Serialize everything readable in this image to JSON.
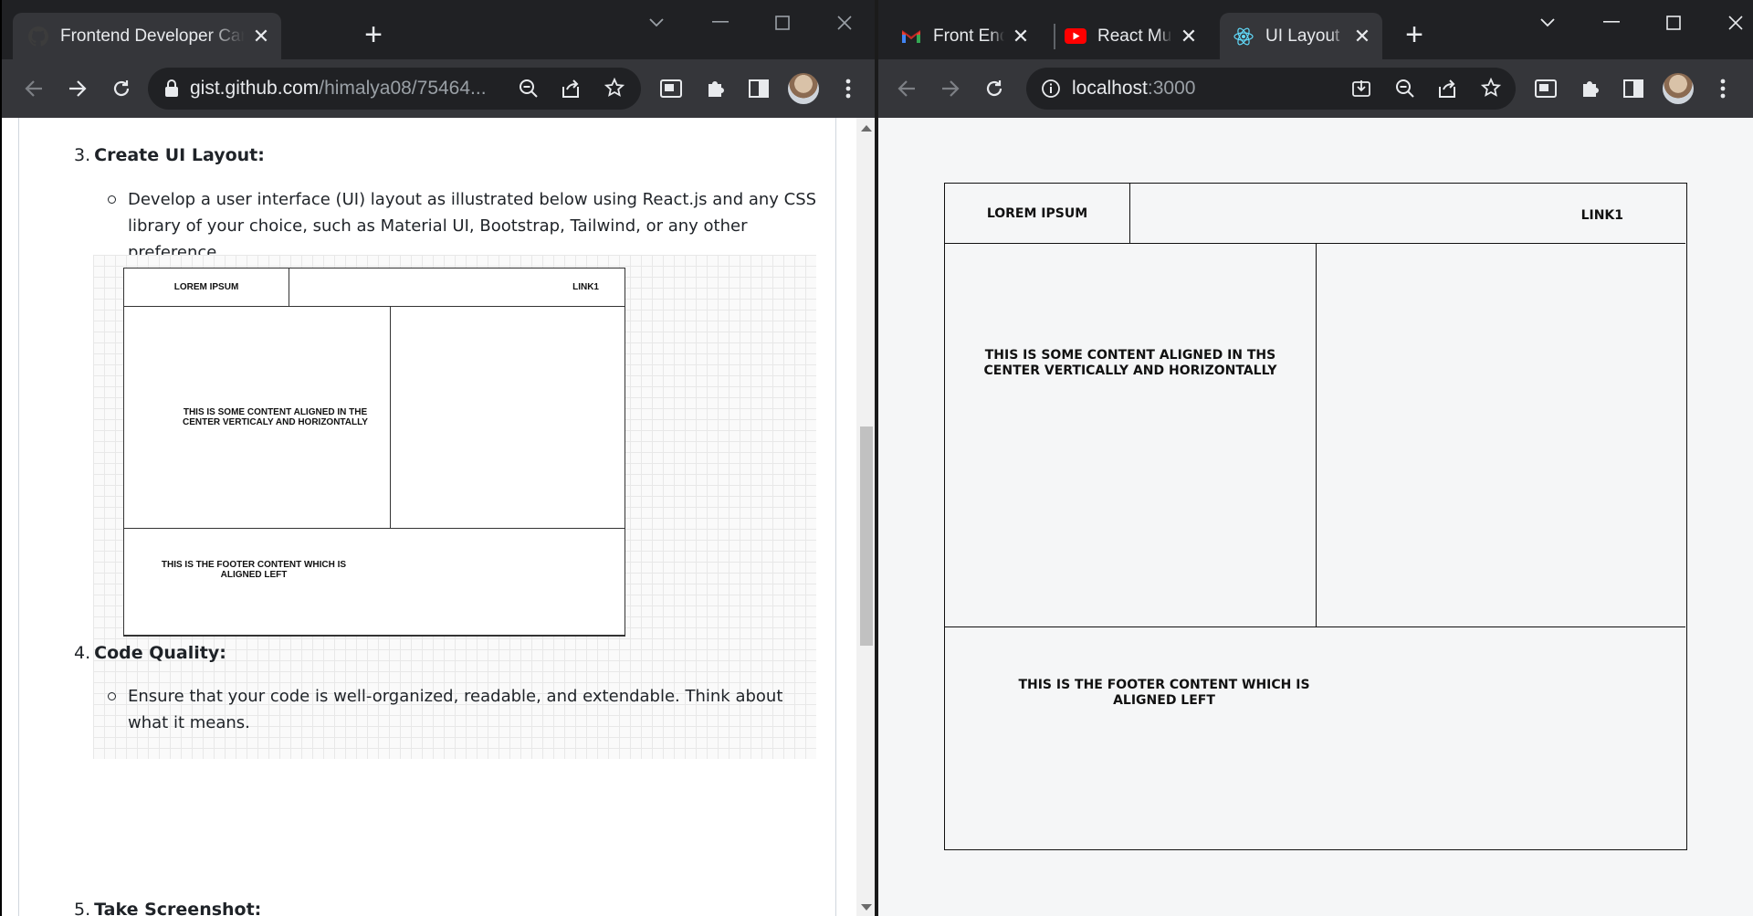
{
  "left_window": {
    "tabs": [
      {
        "title": "Frontend Developer Candidate Screening",
        "active": true
      }
    ],
    "url": {
      "host": "gist.github.com",
      "path": "/himalya08/75464..."
    },
    "doc": {
      "items": [
        {
          "num": "3.",
          "heading": "Create UI Layout:",
          "bullet": "Develop a user interface (UI) layout as illustrated below using React.js and any CSS library of your choice, such as Material UI, Bootstrap, Tailwind, or any other preference."
        },
        {
          "num": "4.",
          "heading": "Code Quality:",
          "bullet": "Ensure that your code is well-organized, readable, and extendable. Think about what it means."
        },
        {
          "num": "5.",
          "heading": "Take Screenshot:"
        }
      ],
      "mock": {
        "logo": "LOREM IPSUM",
        "link": "LINK1",
        "center": "THIS IS SOME CONTENT ALIGNED IN THE CENTER VERTICALY AND HORIZONTALLY",
        "footer": "THIS IS THE FOOTER CONTENT WHICH IS ALIGNED LEFT"
      }
    }
  },
  "right_window": {
    "tabs": [
      {
        "title": "Front End Developer",
        "active": false
      },
      {
        "title": "React Multi",
        "active": false
      },
      {
        "title": "UI Layout",
        "active": true
      }
    ],
    "url": {
      "host": "localhost",
      "port": ":3000"
    },
    "app": {
      "logo": "LOREM IPSUM",
      "link": "LINK1",
      "center": "THIS IS SOME CONTENT ALIGNED IN THS CENTER VERTICALLY AND HORIZONTALLY",
      "footer": "THIS IS THE FOOTER CONTENT WHICH IS ALIGNED LEFT"
    }
  },
  "colors": {
    "tabstrip": "#202124",
    "toolbar": "#35363a",
    "page_bg_right": "#f5f6f7"
  }
}
